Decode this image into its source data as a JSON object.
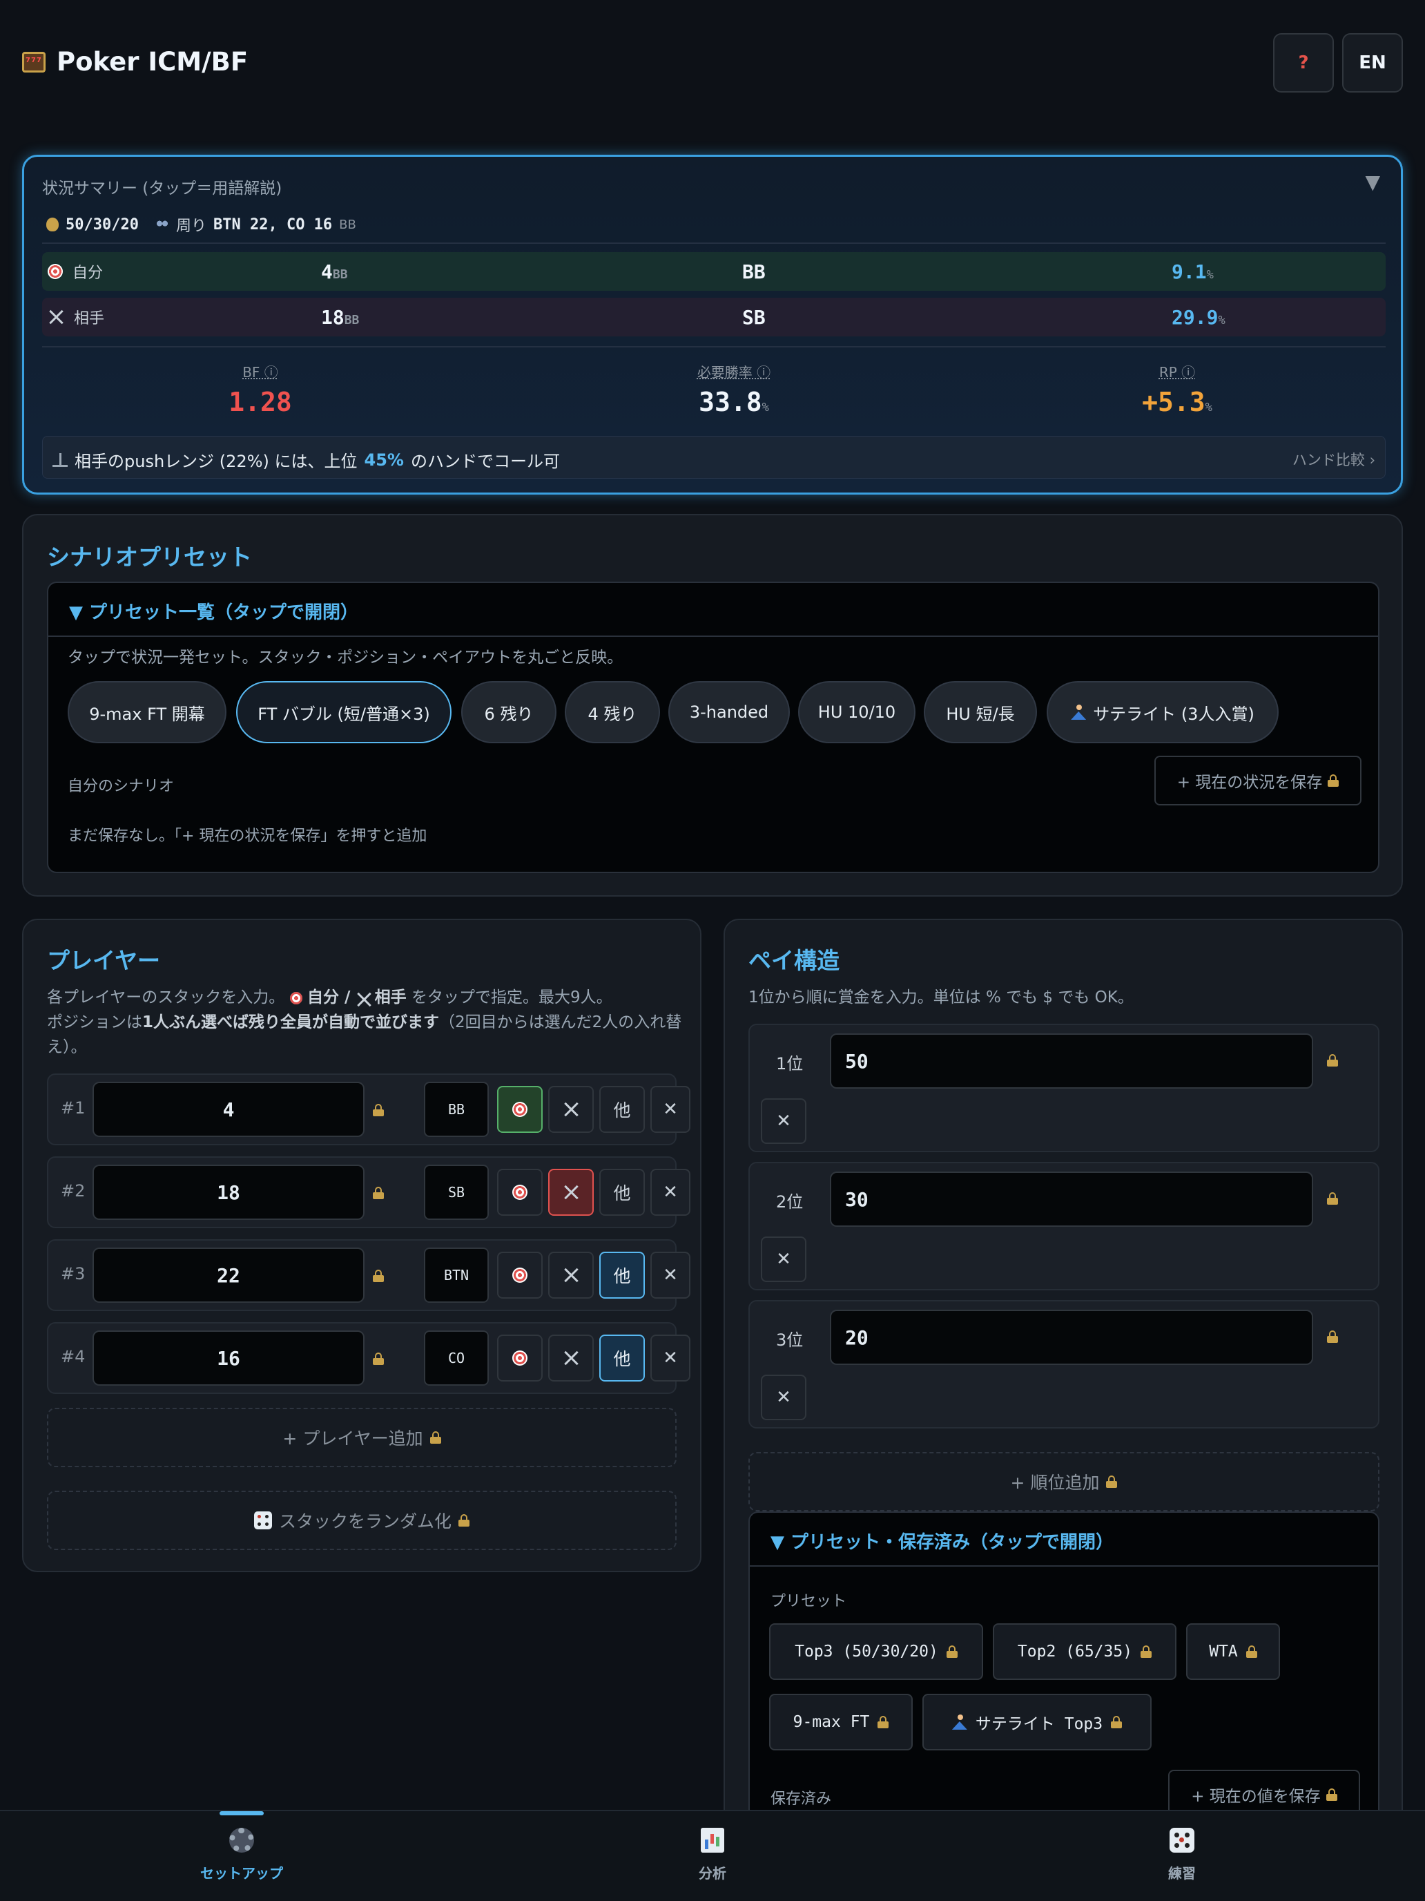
{
  "header": {
    "title": "Poker ICM/BF",
    "help_label": "?",
    "lang_label": "EN"
  },
  "summary": {
    "title": "状況サマリー (タップ＝用語解説)",
    "toggle": "▼",
    "payout": "50/30/20",
    "around_label": "周り",
    "around_value": "BTN 22, CO 16",
    "bb_unit": "BB",
    "pct_unit": "%",
    "self": {
      "label": "自分",
      "stack": "4",
      "position": "BB",
      "equity": "9.1"
    },
    "opponent": {
      "label": "相手",
      "stack": "18",
      "position": "SB",
      "equity": "29.9"
    },
    "bf": {
      "label": "BF ⓘ",
      "value": "1.28"
    },
    "required": {
      "label": "必要勝率 ⓘ",
      "value": "33.8"
    },
    "rp": {
      "label": "RP ⓘ",
      "value": "+5.3"
    },
    "call": {
      "pre": "相手のpushレンジ (22%) には、上位",
      "pct": "45%",
      "post": "のハンドでコール可",
      "link": "ハンド比較 ›"
    }
  },
  "scenario": {
    "title": "シナリオプリセット",
    "accordion_label": "▼ プリセット一覧（タップで開閉）",
    "description": "タップで状況一発セット。スタック・ポジション・ペイアウトを丸ごと反映。",
    "presets": [
      "9-max FT 開幕",
      "FT バブル (短/普通×3)",
      "6 残り",
      "4 残り",
      "3-handed",
      "HU 10/10",
      "HU 短/長",
      "サテライト (3人入賞)"
    ],
    "my_label": "自分のシナリオ",
    "save_label": "+ 現在の状況を保存",
    "empty": "まだ保存なし。「+ 現在の状況を保存」を押すと追加"
  },
  "players": {
    "title": "プレイヤー",
    "desc1_a": "各プレイヤーのスタックを入力。",
    "desc1_self": "自分",
    "desc1_slash": " / ",
    "desc1_opp": "相手",
    "desc1_b": " をタップで指定。最大9人。",
    "desc2_a": "ポジションは",
    "desc2_b": "1人ぶん選べば残り全員が自動で並びます",
    "desc2_c": "（2回目からは選んだ2人の入れ替え）。",
    "other_label": "他",
    "rows": [
      {
        "index": "#1",
        "stack": "4",
        "position": "BB"
      },
      {
        "index": "#2",
        "stack": "18",
        "position": "SB"
      },
      {
        "index": "#3",
        "stack": "22",
        "position": "BTN"
      },
      {
        "index": "#4",
        "stack": "16",
        "position": "CO"
      }
    ],
    "add_label": "+ プレイヤー追加",
    "random_label": "スタックをランダム化"
  },
  "payout": {
    "title": "ペイ構造",
    "description": "1位から順に賞金を入力。単位は % でも $ でも OK。",
    "prizes": [
      {
        "rank": "1位",
        "value": "50"
      },
      {
        "rank": "2位",
        "value": "30"
      },
      {
        "rank": "3位",
        "value": "20"
      }
    ],
    "add_label": "+ 順位追加",
    "accordion_label": "▼ プリセット・保存済み（タップで開閉）",
    "preset_label": "プリセット",
    "presets": [
      "Top3 (50/30/20)",
      "Top2 (65/35)",
      "WTA",
      "9-max FT",
      "サテライト Top3"
    ],
    "saved_label": "保存済み",
    "save_label": "+ 現在の値を保存"
  },
  "nav": {
    "items": [
      {
        "label": "セットアップ",
        "icon": "gear-icon"
      },
      {
        "label": "分析",
        "icon": "chart-icon"
      },
      {
        "label": "練習",
        "icon": "dice-icon"
      }
    ]
  },
  "colors": {
    "accent": "#58b8f0",
    "bf": "#f0524f",
    "rp": "#f2a33a",
    "self_on": "#56b06a",
    "opp_on": "#e0524f"
  }
}
